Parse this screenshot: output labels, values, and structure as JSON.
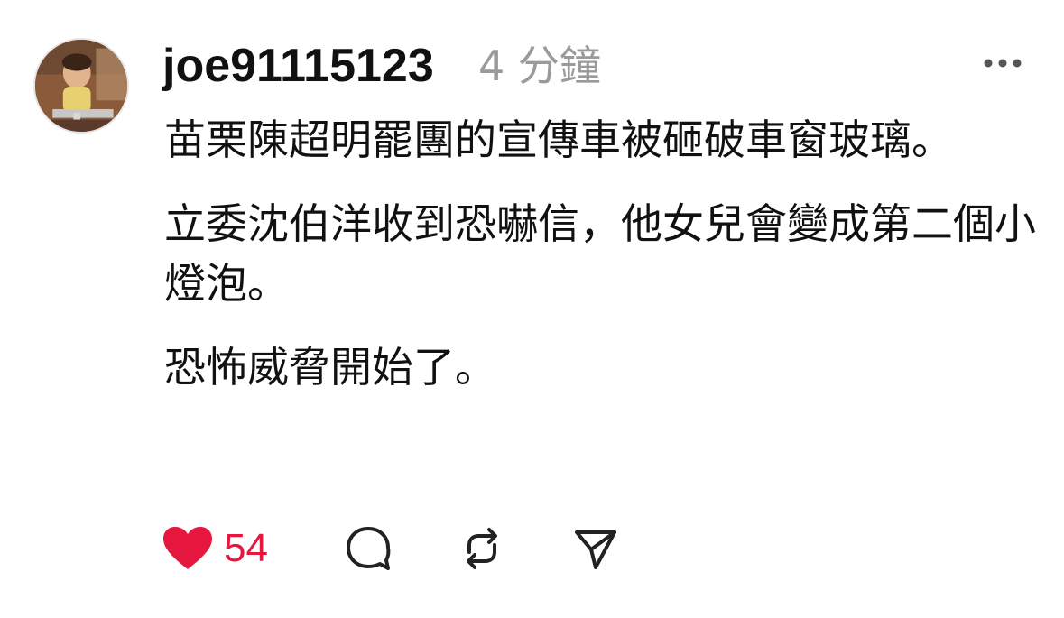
{
  "post": {
    "username": "joe91115123",
    "time": "4 分鐘",
    "paragraphs": [
      "苗栗陳超明罷團的宣傳車被砸破車窗玻璃。",
      "立委沈伯洋收到恐嚇信，他女兒會變成第二個小燈泡。",
      "恐怖威脅開始了。"
    ]
  },
  "actions": {
    "like_count": "54",
    "like_color": "#e5173f",
    "icons": [
      "heart-icon",
      "comment-icon",
      "repost-icon",
      "share-icon"
    ]
  },
  "header": {
    "more_icon": "more-horizontal-icon"
  }
}
